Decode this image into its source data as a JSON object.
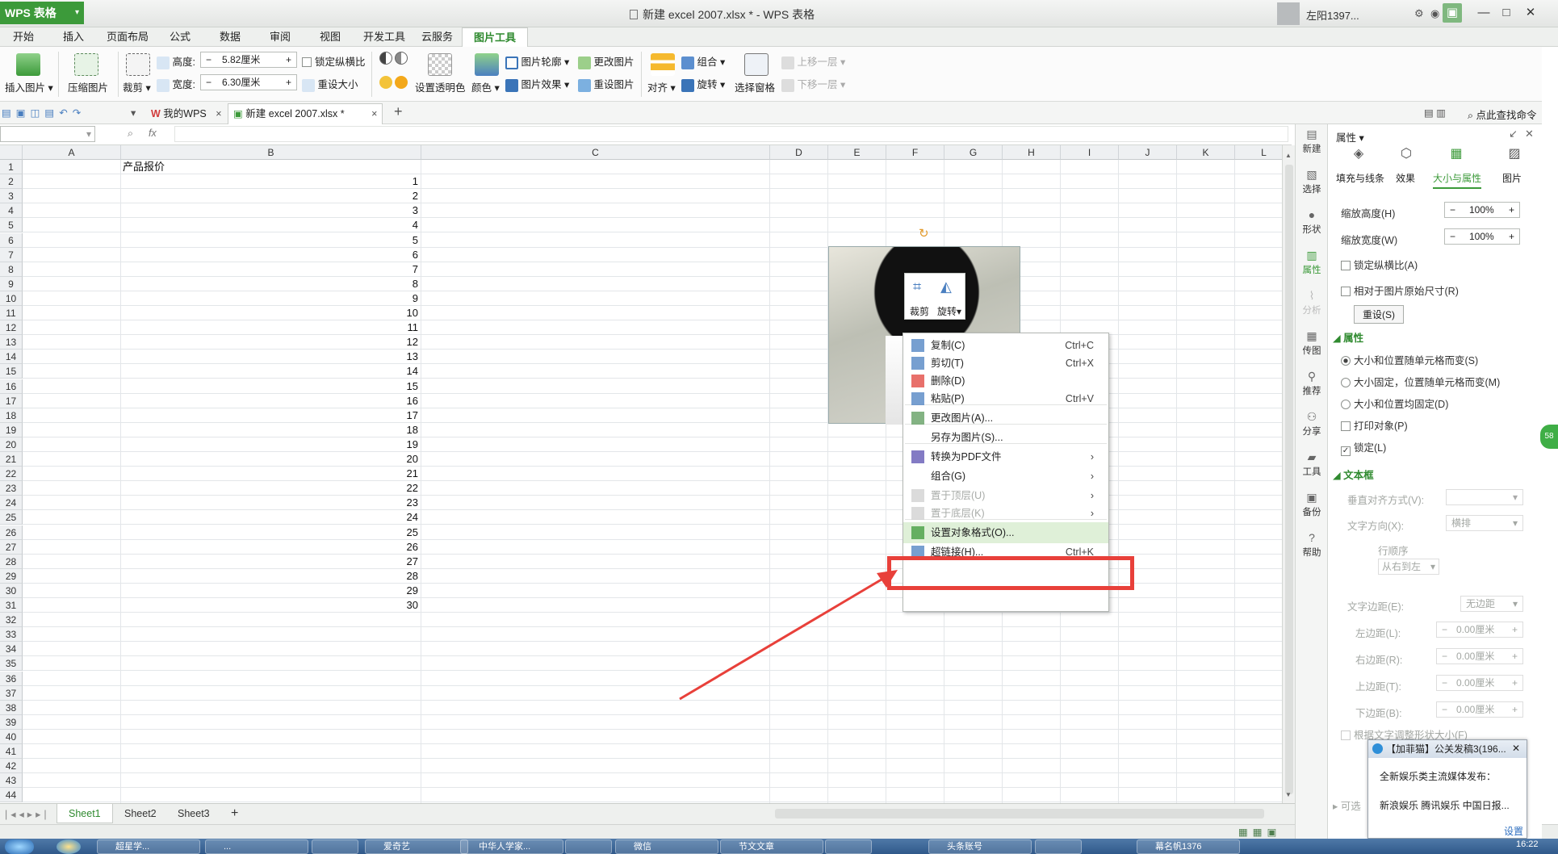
{
  "app": {
    "name": "WPS 表格",
    "doc_title": "新建 excel 2007.xlsx * - WPS 表格",
    "user": "左阳1397...",
    "help": "?"
  },
  "menu": [
    "开始",
    "插入",
    "页面布局",
    "公式",
    "数据",
    "审阅",
    "视图",
    "开发工具",
    "云服务",
    "图片工具"
  ],
  "ribbon": {
    "insert_picture": "插入图片",
    "compress": "压缩图片",
    "crop": "裁剪",
    "height_label": "高度:",
    "height_value": "5.82厘米",
    "width_label": "宽度:",
    "width_value": "6.30厘米",
    "lock_ratio": "锁定纵横比",
    "reset_size": "重设大小",
    "transparent": "设置透明色",
    "color": "颜色",
    "outline": "图片轮廓",
    "effect": "图片效果",
    "change_pic": "更改图片",
    "reset_pic": "重设图片",
    "align": "对齐",
    "group": "组合",
    "rotate": "旋转",
    "selection_pane": "选择窗格",
    "move_up": "上移一层",
    "move_down": "下移一层",
    "find_cmd": "点此查找命令"
  },
  "tabs": {
    "mywps": "我的WPS",
    "doc": "新建 excel 2007.xlsx *"
  },
  "formula": {
    "fx": "fx"
  },
  "grid": {
    "columns": [
      "A",
      "B",
      "C",
      "D",
      "E",
      "F",
      "G",
      "H",
      "I",
      "J",
      "K",
      "L"
    ],
    "header_cell": "产品报价",
    "values": [
      "1",
      "2",
      "3",
      "4",
      "5",
      "6",
      "7",
      "8",
      "9",
      "10",
      "11",
      "12",
      "13",
      "14",
      "15",
      "16",
      "17",
      "18",
      "19",
      "20",
      "21",
      "22",
      "23",
      "24",
      "25",
      "26",
      "27",
      "28",
      "29",
      "30"
    ],
    "row_numbers": [
      "1",
      "2",
      "3",
      "4",
      "5",
      "6",
      "7",
      "8",
      "9",
      "10",
      "11",
      "12",
      "13",
      "14",
      "15",
      "16",
      "17",
      "18",
      "19",
      "20",
      "21",
      "22",
      "23",
      "24",
      "25",
      "26",
      "27",
      "28",
      "29",
      "30",
      "31",
      "32",
      "33",
      "34",
      "35",
      "36",
      "37",
      "38",
      "39",
      "40",
      "41",
      "42",
      "43",
      "44"
    ]
  },
  "image_toolbar": {
    "crop": "裁剪",
    "rotate": "旋转"
  },
  "context_menu": [
    {
      "label": "复制(C)",
      "shortcut": "Ctrl+C"
    },
    {
      "label": "剪切(T)",
      "shortcut": "Ctrl+X"
    },
    {
      "label": "删除(D)",
      "shortcut": ""
    },
    {
      "label": "粘贴(P)",
      "shortcut": "Ctrl+V"
    },
    {
      "label": "更改图片(A)...",
      "shortcut": ""
    },
    {
      "label": "另存为图片(S)...",
      "shortcut": ""
    },
    {
      "label": "转换为PDF文件",
      "shortcut": "›"
    },
    {
      "label": "组合(G)",
      "shortcut": "›"
    },
    {
      "label": "置于顶层(U)",
      "shortcut": "›"
    },
    {
      "label": "置于底层(K)",
      "shortcut": "›"
    },
    {
      "label": "设置对象格式(O)...",
      "shortcut": ""
    },
    {
      "label": "超链接(H)...",
      "shortcut": "Ctrl+K"
    }
  ],
  "sheets": [
    "Sheet1",
    "Sheet2",
    "Sheet3"
  ],
  "sidenav": [
    "新建",
    "选择",
    "形状",
    "属性",
    "分析",
    "传图",
    "推荐",
    "分享",
    "工具",
    "备份",
    "帮助"
  ],
  "panel": {
    "title": "属性",
    "tabs": [
      "填充与线条",
      "效果",
      "大小与属性",
      "图片"
    ],
    "scale_h_label": "缩放高度(H)",
    "scale_h": "100%",
    "scale_w_label": "缩放宽度(W)",
    "scale_w": "100%",
    "lock_ratio": "锁定纵横比(A)",
    "relative": "相对于图片原始尺寸(R)",
    "reset": "重设(S)",
    "props_section": "属性",
    "opt1": "大小和位置随单元格而变(S)",
    "opt2": "大小固定，位置随单元格而变(M)",
    "opt3": "大小和位置均固定(D)",
    "print_obj": "打印对象(P)",
    "locked": "锁定(L)",
    "textbox_section": "文本框",
    "valign_label": "垂直对齐方式(V):",
    "dir_label": "文字方向(X):",
    "dir_value": "横排",
    "row_order": "行顺序",
    "row_order_value": "从右到左",
    "margin_label": "文字边距(E):",
    "margin_value": "无边距",
    "left": "左边距(L):",
    "right": "右边距(R):",
    "top": "上边距(T):",
    "bottom": "下边距(B):",
    "margin_num": "0.00厘米",
    "autofit": "根据文字调整形状大小(F)",
    "opt_can": "可选"
  },
  "popup": {
    "title": "【加菲猫】公关发稿3(196...",
    "line1": "全新娱乐类主流媒体发布：",
    "line2": "新浪娱乐  腾讯娱乐  中国日报...",
    "settings": "设置"
  },
  "taskbar": {
    "items": [
      "超星学...",
      "...",
      "",
      "爱奇艺",
      "中华人学家...",
      "",
      "微信",
      "节文文章",
      "",
      "头条账号",
      "",
      "幕名帆1376"
    ],
    "clock": "16:22"
  },
  "colors": {
    "accent": "#3c9a3a",
    "highlight": "#dff0d8",
    "arrow": "#e8403a"
  }
}
